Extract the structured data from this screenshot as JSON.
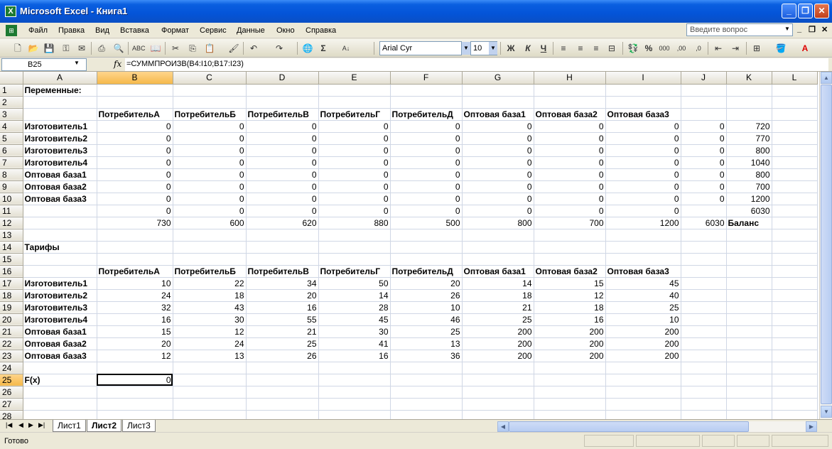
{
  "window": {
    "title": "Microsoft Excel - Книга1",
    "app_icon": "excel-icon"
  },
  "menu": [
    "Файл",
    "Правка",
    "Вид",
    "Вставка",
    "Формат",
    "Сервис",
    "Данные",
    "Окно",
    "Справка"
  ],
  "help_placeholder": "Введите вопрос",
  "toolbar": {
    "font_name": "Arial Cyr",
    "font_size": "10",
    "bold": "Ж",
    "italic": "К",
    "underline": "Ч",
    "percent": "%",
    "thousands": "000",
    "sum": "Σ"
  },
  "formula_bar": {
    "name_box": "B25",
    "fx": "fx",
    "formula": "=СУММПРОИЗВ(B4:I10;B17:I23)"
  },
  "columns": [
    "A",
    "B",
    "C",
    "D",
    "E",
    "F",
    "G",
    "H",
    "I",
    "J",
    "K",
    "L"
  ],
  "selected_cell": "B25",
  "rows": [
    {
      "n": "1",
      "cells": [
        "Переменные:",
        "",
        "",
        "",
        "",
        "",
        "",
        "",
        "",
        "",
        "",
        ""
      ]
    },
    {
      "n": "2",
      "cells": [
        "",
        "",
        "",
        "",
        "",
        "",
        "",
        "",
        "",
        "",
        "",
        ""
      ]
    },
    {
      "n": "3",
      "cells": [
        "",
        "ПотребительА",
        "ПотребительБ",
        "ПотребительВ",
        "ПотребительГ",
        "ПотребительД",
        "Оптовая база1",
        "Оптовая база2",
        "Оптовая база3",
        "",
        "",
        ""
      ]
    },
    {
      "n": "4",
      "cells": [
        "Изготовитель1",
        "0",
        "0",
        "0",
        "0",
        "0",
        "0",
        "0",
        "0",
        "0",
        "720",
        ""
      ]
    },
    {
      "n": "5",
      "cells": [
        "Изготовитель2",
        "0",
        "0",
        "0",
        "0",
        "0",
        "0",
        "0",
        "0",
        "0",
        "770",
        ""
      ]
    },
    {
      "n": "6",
      "cells": [
        "Изготовитель3",
        "0",
        "0",
        "0",
        "0",
        "0",
        "0",
        "0",
        "0",
        "0",
        "800",
        ""
      ]
    },
    {
      "n": "7",
      "cells": [
        "Изготовитель4",
        "0",
        "0",
        "0",
        "0",
        "0",
        "0",
        "0",
        "0",
        "0",
        "1040",
        ""
      ]
    },
    {
      "n": "8",
      "cells": [
        "Оптовая база1",
        "0",
        "0",
        "0",
        "0",
        "0",
        "0",
        "0",
        "0",
        "0",
        "800",
        ""
      ]
    },
    {
      "n": "9",
      "cells": [
        "Оптовая база2",
        "0",
        "0",
        "0",
        "0",
        "0",
        "0",
        "0",
        "0",
        "0",
        "700",
        ""
      ]
    },
    {
      "n": "10",
      "cells": [
        "Оптовая база3",
        "0",
        "0",
        "0",
        "0",
        "0",
        "0",
        "0",
        "0",
        "0",
        "1200",
        ""
      ]
    },
    {
      "n": "11",
      "cells": [
        "",
        "0",
        "0",
        "0",
        "0",
        "0",
        "0",
        "0",
        "0",
        "",
        "6030",
        ""
      ]
    },
    {
      "n": "12",
      "cells": [
        "",
        "730",
        "600",
        "620",
        "880",
        "500",
        "800",
        "700",
        "1200",
        "6030",
        "Баланс",
        ""
      ]
    },
    {
      "n": "13",
      "cells": [
        "",
        "",
        "",
        "",
        "",
        "",
        "",
        "",
        "",
        "",
        "",
        ""
      ]
    },
    {
      "n": "14",
      "cells": [
        "Тарифы",
        "",
        "",
        "",
        "",
        "",
        "",
        "",
        "",
        "",
        "",
        ""
      ]
    },
    {
      "n": "15",
      "cells": [
        "",
        "",
        "",
        "",
        "",
        "",
        "",
        "",
        "",
        "",
        "",
        ""
      ]
    },
    {
      "n": "16",
      "cells": [
        "",
        "ПотребительА",
        "ПотребительБ",
        "ПотребительВ",
        "ПотребительГ",
        "ПотребительД",
        "Оптовая база1",
        "Оптовая база2",
        "Оптовая база3",
        "",
        "",
        ""
      ]
    },
    {
      "n": "17",
      "cells": [
        "Изготовитель1",
        "10",
        "22",
        "34",
        "50",
        "20",
        "14",
        "15",
        "45",
        "",
        "",
        ""
      ]
    },
    {
      "n": "18",
      "cells": [
        "Изготовитель2",
        "24",
        "18",
        "20",
        "14",
        "26",
        "18",
        "12",
        "40",
        "",
        "",
        ""
      ]
    },
    {
      "n": "19",
      "cells": [
        "Изготовитель3",
        "32",
        "43",
        "16",
        "28",
        "10",
        "21",
        "18",
        "25",
        "",
        "",
        ""
      ]
    },
    {
      "n": "20",
      "cells": [
        "Изготовитель4",
        "16",
        "30",
        "55",
        "45",
        "46",
        "25",
        "16",
        "10",
        "",
        "",
        ""
      ]
    },
    {
      "n": "21",
      "cells": [
        "Оптовая база1",
        "15",
        "12",
        "21",
        "30",
        "25",
        "200",
        "200",
        "200",
        "",
        "",
        ""
      ]
    },
    {
      "n": "22",
      "cells": [
        "Оптовая база2",
        "20",
        "24",
        "25",
        "41",
        "13",
        "200",
        "200",
        "200",
        "",
        "",
        ""
      ]
    },
    {
      "n": "23",
      "cells": [
        "Оптовая база3",
        "12",
        "13",
        "26",
        "16",
        "36",
        "200",
        "200",
        "200",
        "",
        "",
        ""
      ]
    },
    {
      "n": "24",
      "cells": [
        "",
        "",
        "",
        "",
        "",
        "",
        "",
        "",
        "",
        "",
        "",
        ""
      ]
    },
    {
      "n": "25",
      "cells": [
        "F(x)",
        "0",
        "",
        "",
        "",
        "",
        "",
        "",
        "",
        "",
        "",
        ""
      ]
    },
    {
      "n": "26",
      "cells": [
        "",
        "",
        "",
        "",
        "",
        "",
        "",
        "",
        "",
        "",
        "",
        ""
      ]
    },
    {
      "n": "27",
      "cells": [
        "",
        "",
        "",
        "",
        "",
        "",
        "",
        "",
        "",
        "",
        "",
        ""
      ]
    },
    {
      "n": "28",
      "cells": [
        "",
        "",
        "",
        "",
        "",
        "",
        "",
        "",
        "",
        "",
        "",
        ""
      ]
    }
  ],
  "sheets": [
    "Лист1",
    "Лист2",
    "Лист3"
  ],
  "active_sheet": "Лист2",
  "status": "Готово"
}
